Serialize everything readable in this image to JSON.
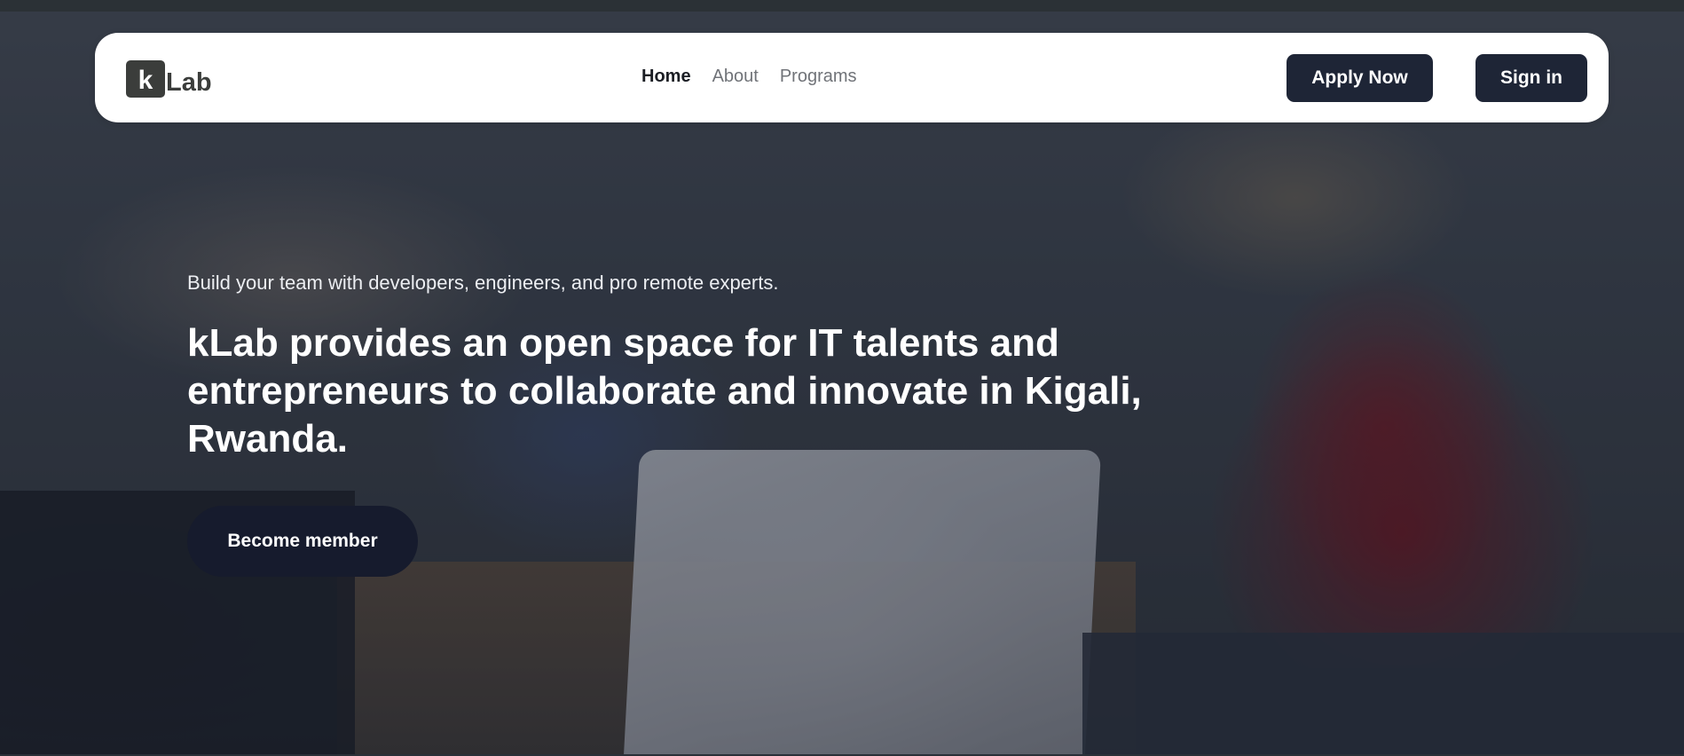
{
  "nav": {
    "logo_letter": "k",
    "logo_rest": "Lab",
    "links": [
      "Home",
      "About",
      "Programs"
    ],
    "apply_label": "Apply Now",
    "signin_label": "Sign in"
  },
  "hero": {
    "tagline": "Build your team with developers, engineers, and pro remote experts.",
    "headline": "kLab provides an open space for IT talents and entrepreneurs to collaborate and innovate in Kigali, Rwanda.",
    "cta_label": "Become member"
  },
  "colors": {
    "button_dark": "#1e2536",
    "navbar_bg": "#ffffff",
    "logo_dark": "#3b3d3b"
  }
}
